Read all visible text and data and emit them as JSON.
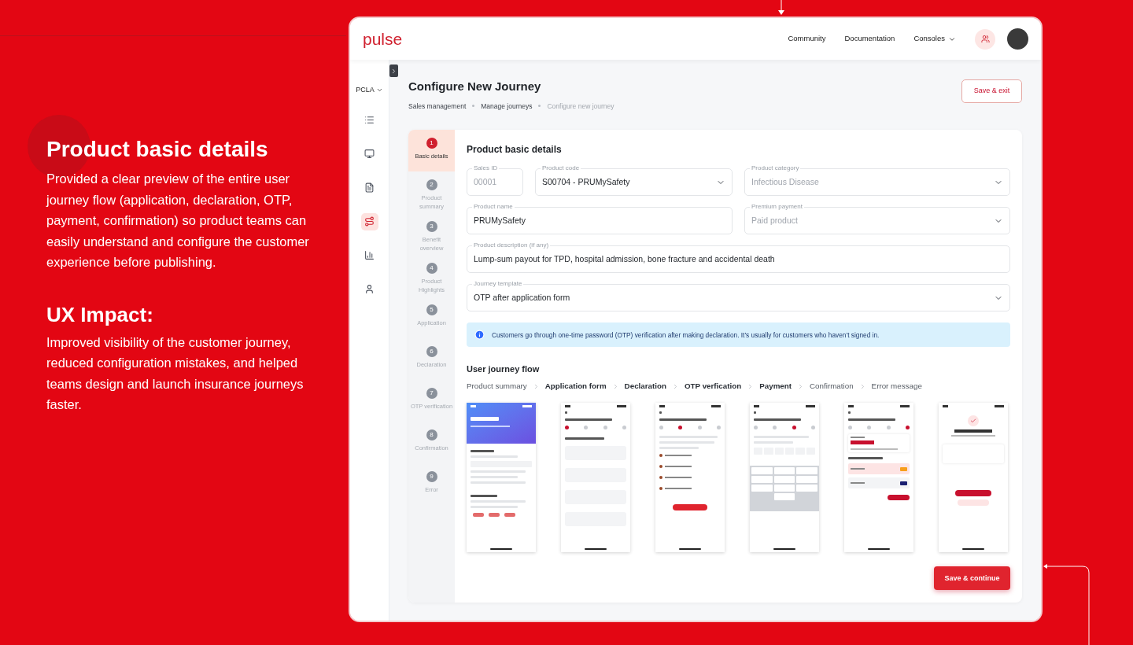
{
  "intro": {
    "heading": "Product basic details",
    "body": "Provided a clear preview of the entire user journey flow (application, declaration, OTP, payment, confirmation) so product teams can easily understand and configure the customer experience before publishing.",
    "impact_heading": "UX Impact:",
    "impact_body": "Improved visibility of the customer journey, reduced configuration mistakes, and helped teams design and launch insurance journeys faster."
  },
  "nav": {
    "logo": "pulse",
    "links": [
      {
        "label": "Community",
        "dropdown": false
      },
      {
        "label": "Documentation",
        "dropdown": false
      },
      {
        "label": "Consoles",
        "dropdown": true
      }
    ]
  },
  "rail": {
    "workspace": "PCLA",
    "items": [
      {
        "selected": false
      },
      {
        "selected": false
      },
      {
        "selected": false
      },
      {
        "selected": true
      },
      {
        "selected": false
      },
      {
        "selected": false
      }
    ]
  },
  "page": {
    "title": "Configure New Journey",
    "breadcrumbs": [
      {
        "label": "Sales management",
        "current": false
      },
      {
        "label": "Manage journeys",
        "current": false
      },
      {
        "label": "Configure new journey",
        "current": true
      }
    ],
    "save_exit": "Save & exit"
  },
  "steps": [
    {
      "number": "1",
      "label": "Basic details",
      "selected": true
    },
    {
      "number": "2",
      "label": "Product summary",
      "selected": false
    },
    {
      "number": "3",
      "label": "Benefit overview",
      "selected": false
    },
    {
      "number": "4",
      "label": "Product Highlights",
      "selected": false
    },
    {
      "number": "5",
      "label": "Application",
      "selected": false
    },
    {
      "number": "6",
      "label": "Declaration",
      "selected": false
    },
    {
      "number": "7",
      "label": "OTP verification",
      "selected": false
    },
    {
      "number": "8",
      "label": "Confirmation",
      "selected": false
    },
    {
      "number": "9",
      "label": "Error",
      "selected": false
    }
  ],
  "form": {
    "title": "Product basic details",
    "fields": [
      {
        "label": "Sales ID",
        "value": "00001",
        "kind": "input",
        "disabled": true
      },
      {
        "label": "Product code",
        "value": "S00704 - PRUMySafety",
        "kind": "select",
        "disabled": false
      },
      {
        "label": "Product category",
        "value": "Infectious Disease",
        "kind": "select",
        "disabled": true
      },
      {
        "label": "Product name",
        "value": "PRUMySafety",
        "kind": "input",
        "disabled": false
      },
      {
        "label": "Premium payment",
        "value": "Paid product",
        "kind": "select",
        "disabled": true
      },
      {
        "label": "Product description (if any)",
        "value": "Lump-sum payout for TPD, hospital admission, bone fracture and accidental death",
        "kind": "input",
        "disabled": false
      },
      {
        "label": "Journey template",
        "value": "OTP after application form",
        "kind": "select",
        "disabled": false
      }
    ],
    "info": "Customers go through one-time password (OTP) verification after making declaration. It’s usually for customers who haven’t signed in."
  },
  "journey": {
    "title": "User journey flow",
    "steps": [
      {
        "label": "Product summary",
        "highlighted": false
      },
      {
        "label": "Application form",
        "highlighted": true
      },
      {
        "label": "Declaration",
        "highlighted": true
      },
      {
        "label": "OTP verfication",
        "highlighted": true
      },
      {
        "label": "Payment",
        "highlighted": true
      },
      {
        "label": "Confirmation",
        "highlighted": false
      },
      {
        "label": "Error message",
        "highlighted": false
      }
    ],
    "screens": [
      {
        "kind": "product"
      },
      {
        "kind": "form",
        "progress": [
          {
            "selected": true
          },
          {
            "selected": false
          },
          {
            "selected": false
          },
          {
            "selected": false
          }
        ]
      },
      {
        "kind": "declaration",
        "progress": [
          {
            "selected": false
          },
          {
            "selected": true
          },
          {
            "selected": false
          },
          {
            "selected": false
          }
        ]
      },
      {
        "kind": "otp",
        "progress": [
          {
            "selected": false
          },
          {
            "selected": false
          },
          {
            "selected": true
          },
          {
            "selected": false
          }
        ]
      },
      {
        "kind": "payment",
        "progress": [
          {
            "selected": false
          },
          {
            "selected": false
          },
          {
            "selected": false
          },
          {
            "selected": true
          }
        ],
        "methods": [
          {
            "selected": true
          },
          {
            "selected": false
          }
        ]
      },
      {
        "kind": "confirmation"
      }
    ],
    "save_continue": "Save & continue"
  }
}
